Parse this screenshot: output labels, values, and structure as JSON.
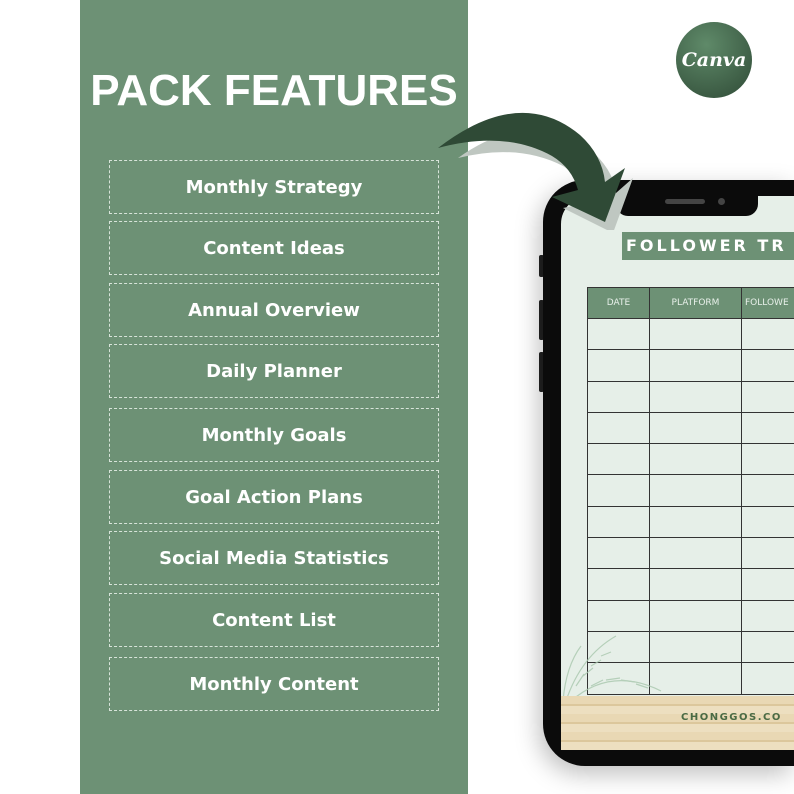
{
  "panel": {
    "title": "PACK FEATURES",
    "features": [
      "Monthly Strategy",
      "Content Ideas",
      "Annual Overview",
      "Daily Planner",
      "Monthly Goals",
      "Goal Action Plans",
      "Social Media Statistics",
      "Content List",
      "Monthly Content"
    ]
  },
  "badge": {
    "label": "Canva"
  },
  "phone": {
    "sheet_title": "FOLLOWER TR",
    "columns": [
      "DATE",
      "PLATFORM",
      "FOLLOWE"
    ],
    "footer": "CHONGGOS.CO"
  },
  "colors": {
    "panel": "#6d9175",
    "dark": "#2f4a36"
  }
}
